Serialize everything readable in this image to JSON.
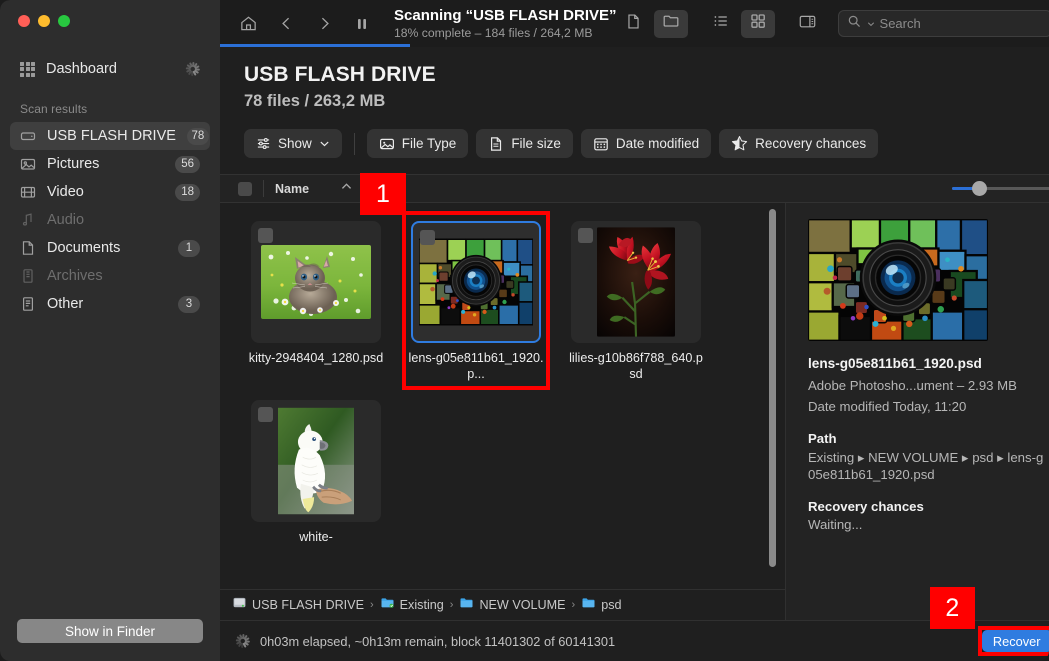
{
  "window": {
    "traffic_lights": [
      "close",
      "minimize",
      "maximize"
    ]
  },
  "sidebar": {
    "dashboard": {
      "label": "Dashboard",
      "icon": "grid-icon",
      "spinner": "spinner-icon"
    },
    "section_label": "Scan results",
    "items": [
      {
        "label": "USB FLASH DRIVE",
        "count": "78",
        "icon": "drive-icon",
        "active": true,
        "dim": false
      },
      {
        "label": "Pictures",
        "count": "56",
        "icon": "image-icon",
        "active": false,
        "dim": false
      },
      {
        "label": "Video",
        "count": "18",
        "icon": "video-icon",
        "active": false,
        "dim": false
      },
      {
        "label": "Audio",
        "count": "",
        "icon": "music-note-icon",
        "active": false,
        "dim": true
      },
      {
        "label": "Documents",
        "count": "1",
        "icon": "document-icon",
        "active": false,
        "dim": false
      },
      {
        "label": "Archives",
        "count": "",
        "icon": "archive-icon",
        "active": false,
        "dim": true
      },
      {
        "label": "Other",
        "count": "3",
        "icon": "file-icon",
        "active": false,
        "dim": false
      }
    ],
    "show_in_finder": "Show in Finder"
  },
  "toolbar": {
    "home_icon": "home-icon",
    "back_icon": "chevron-left-icon",
    "forward_icon": "chevron-right-icon",
    "pause_icon": "pause-icon",
    "scan_title": "Scanning “USB FLASH DRIVE”",
    "scan_subtitle": "18% complete – 184 files / 264,2 MB",
    "progress_percent": 18,
    "view_icons": [
      "file-view-icon",
      "folder-view-icon",
      "list-view-icon",
      "grid-view-icon",
      "sidebar-panel-icon"
    ],
    "folder_view_active": true,
    "grid_view_active": true,
    "search_placeholder": "Search",
    "search_value": ""
  },
  "header": {
    "title": "USB FLASH DRIVE",
    "subtitle": "78 files / 263,2 MB"
  },
  "filters": {
    "show_label": "Show",
    "chips": [
      {
        "label": "File Type",
        "icon": "image-icon"
      },
      {
        "label": "File size",
        "icon": "document-icon"
      },
      {
        "label": "Date modified",
        "icon": "calendar-icon"
      },
      {
        "label": "Recovery chances",
        "icon": "star-half-icon"
      }
    ]
  },
  "column_bar": {
    "name_label": "Name",
    "sort_direction": "ascending",
    "filter_icon": "sliders-icon",
    "zoom_slider_value": 22
  },
  "files": [
    {
      "name": "kitty-2948404_1280.psd",
      "thumb": "kitten-photo",
      "selected": false,
      "checked": false
    },
    {
      "name": "lens-g05e811b61_1920.p...",
      "thumb": "lens-mosaic",
      "selected": true,
      "checked": false
    },
    {
      "name": "lilies-g10b86f788_640.psd",
      "thumb": "red-lilies-photo",
      "selected": false,
      "checked": false
    },
    {
      "name": "white-",
      "thumb": "white-cockatoo-photo",
      "selected": false,
      "checked": false
    }
  ],
  "breadcrumb": [
    {
      "label": "USB FLASH DRIVE",
      "icon": "drive-icon"
    },
    {
      "label": "Existing",
      "icon": "folder-badge-icon"
    },
    {
      "label": "NEW VOLUME",
      "icon": "folder-icon"
    },
    {
      "label": "psd",
      "icon": "folder-icon"
    }
  ],
  "detail": {
    "preview_thumb": "lens-mosaic",
    "filename": "lens-g05e811b61_1920.psd",
    "kind_and_size": "Adobe Photosho...ument – 2.93 MB",
    "date_modified": "Date modified  Today, 11:20",
    "path_heading": "Path",
    "path_value": "Existing ▸ NEW VOLUME ▸ psd ▸ lens-g05e811b61_1920.psd",
    "recovery_heading": "Recovery chances",
    "recovery_value": "Waiting..."
  },
  "status": {
    "spinner": "spinner-icon",
    "text": "0h03m elapsed, ~0h13m remain, block 11401302 of 60141301",
    "recover_label": "Recover"
  },
  "annotations": [
    {
      "number": "1",
      "target": "selected-file-tile"
    },
    {
      "number": "2",
      "target": "recover-button"
    }
  ],
  "colors": {
    "accent_blue": "#2f7ce0",
    "annotation_red": "#ff0000",
    "sidebar_bg": "#2d2d2d",
    "main_bg": "#1f1f1f"
  }
}
